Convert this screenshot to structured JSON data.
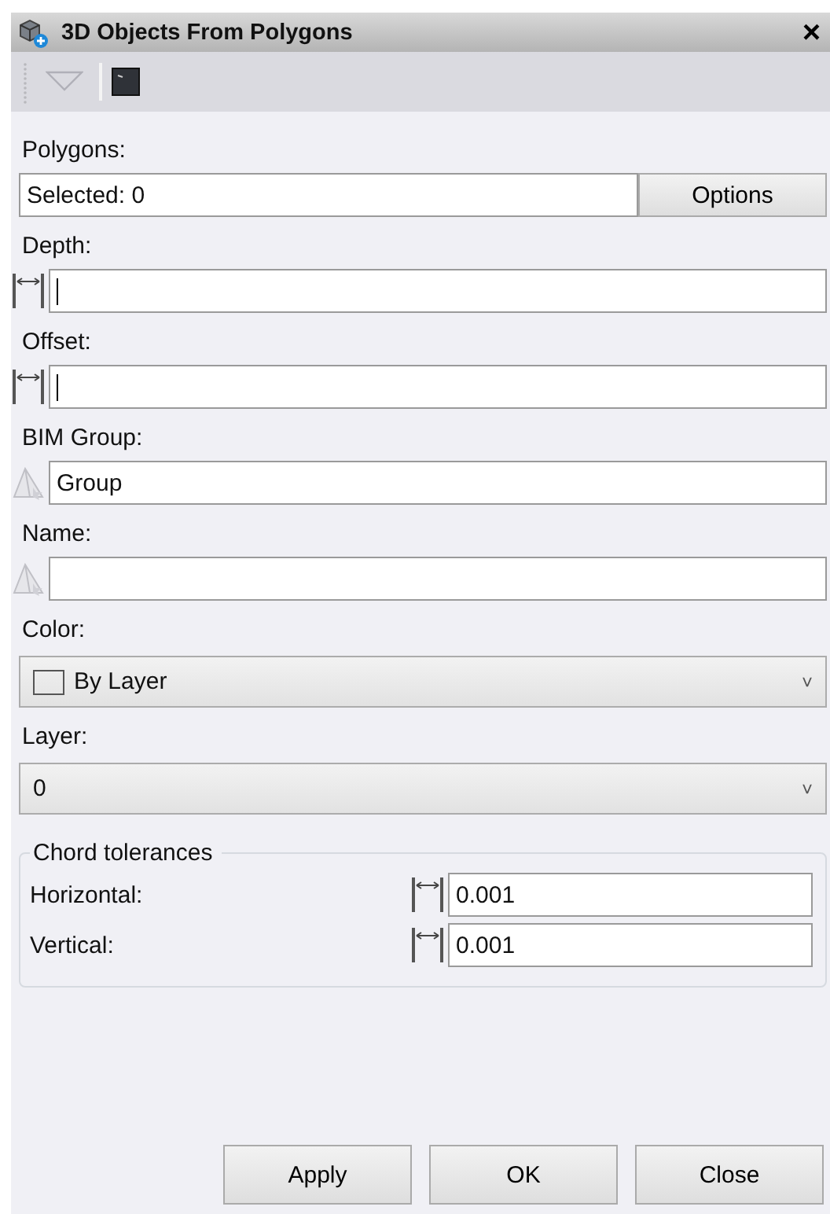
{
  "window": {
    "title": "3D Objects From Polygons",
    "close": "×"
  },
  "polygons": {
    "label": "Polygons:",
    "value": "Selected: 0",
    "button": "Options"
  },
  "fields": [
    {
      "label": "Depth:",
      "kind": "distance",
      "focused": true
    },
    {
      "label": "Offset:",
      "kind": "distance",
      "focused": true
    },
    {
      "label": "BIM Group:",
      "kind": "group",
      "value": "Group",
      "focused": false
    },
    {
      "label": "Name:",
      "kind": "group",
      "focused": false
    },
    {
      "label": "Color:",
      "kind": "swatch-select",
      "value": "By Layer",
      "caret": "˅"
    },
    {
      "label": "Layer:",
      "kind": "select",
      "value": "0",
      "caret": "˅"
    }
  ],
  "chord_tolerances": {
    "title": "Chord tolerances",
    "rows": [
      {
        "label": "Horizontal:",
        "value": "0.001"
      },
      {
        "label": "Vertical:",
        "value": "0.001"
      }
    ]
  },
  "buttons": [
    "Apply",
    "OK",
    "Close"
  ]
}
